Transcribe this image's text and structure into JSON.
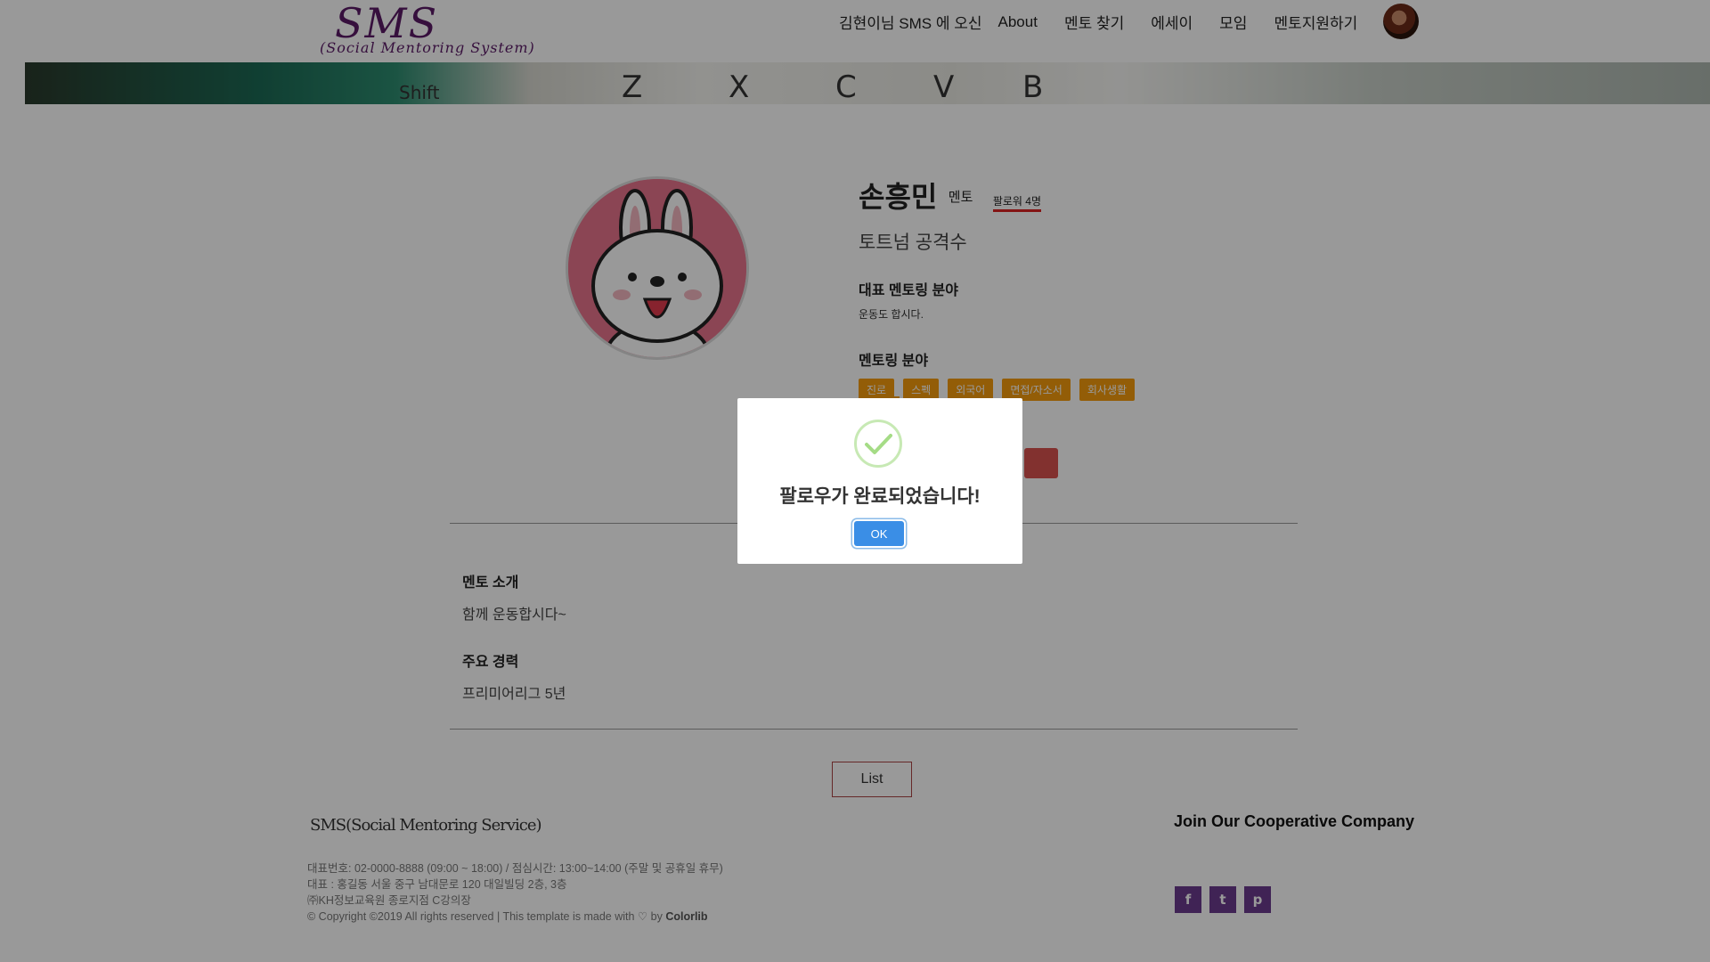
{
  "header": {
    "logo_main": "SMS",
    "logo_sub": "(Social Mentoring System)",
    "nav": {
      "welcome": "김현이님 SMS 에 오신",
      "about": "About",
      "find_mentor": "멘토 찾기",
      "essay": "에세이",
      "meeting": "모임",
      "apply_mentor": "멘토지원하기"
    }
  },
  "banner": {
    "keys": [
      "Shift",
      "Z",
      "X",
      "C",
      "V",
      "B"
    ]
  },
  "profile": {
    "name": "손흥민",
    "role": "멘토",
    "followers": "팔로워 4명",
    "position": "토트넘 공격수",
    "rep_field_label": "대표 멘토링 분야",
    "rep_field_value": "운동도 합시다.",
    "fields_label": "멘토링 분야",
    "tags": [
      "진로",
      "스펙",
      "외국어",
      "면접/자소서",
      "회사생활"
    ]
  },
  "sections": {
    "intro_label": "멘토 소개",
    "intro_text": "함께 운동합시다~",
    "career_label": "주요 경력",
    "career_text": "프리미어리그 5년"
  },
  "list_button": "List",
  "footer": {
    "logo": "SMS(Social Mentoring Service)",
    "line1": "대표번호: 02-0000-8888 (09:00 ~ 18:00) / 점심시간: 13:00~14:00 (주말 및 공휴일 휴무)",
    "line2": "대표 : 홍길동 서울 중구 남대문로 120 대일빌딩 2층, 3층",
    "line3": "㈜KH정보교육원 종로지점 C강의장",
    "copyright": "© Copyright ©2019 All rights reserved | This template is made with",
    "by": "by",
    "colorlib": "Colorlib",
    "join": "Join Our Cooperative Company",
    "social_icons": [
      "facebook-icon",
      "twitter-icon",
      "pinterest-icon"
    ]
  },
  "modal": {
    "message": "팔로우가 완료되었습니다!",
    "ok_label": "OK",
    "check_color": "#a5dc86"
  },
  "colors": {
    "tag_bg": "#f59b0c",
    "ok_button": "#3a8ee6",
    "brand_purple": "#5a1a66",
    "social_bg": "#6b3b8e"
  }
}
